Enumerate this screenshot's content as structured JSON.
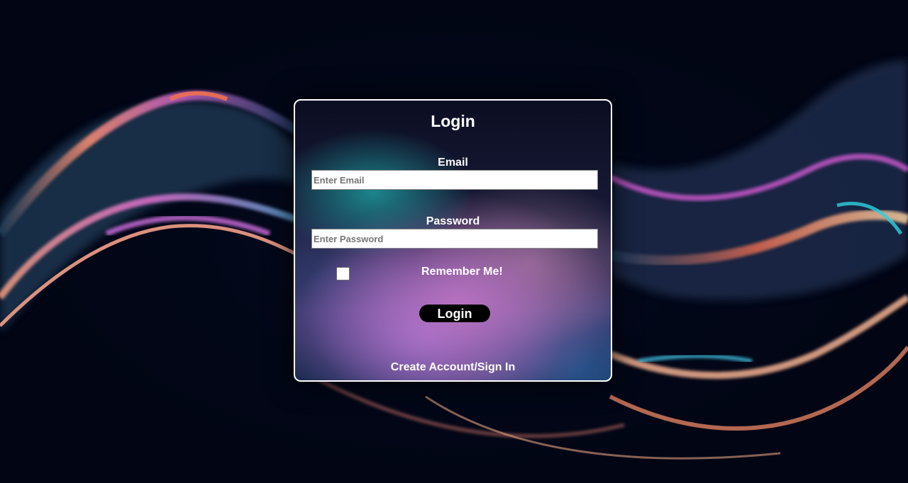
{
  "login_form": {
    "title": "Login",
    "email_label": "Email",
    "email_placeholder": "Enter Email",
    "email_value": "",
    "password_label": "Password",
    "password_placeholder": "Enter Password",
    "password_value": "",
    "remember_label": "Remember Me!",
    "remember_checked": false,
    "submit_label": "Login",
    "create_account_link": "Create Account/Sign In"
  },
  "colors": {
    "page_background": "#010514",
    "card_border": "#ffffff",
    "button_background": "#000000",
    "text": "#ffffff"
  }
}
